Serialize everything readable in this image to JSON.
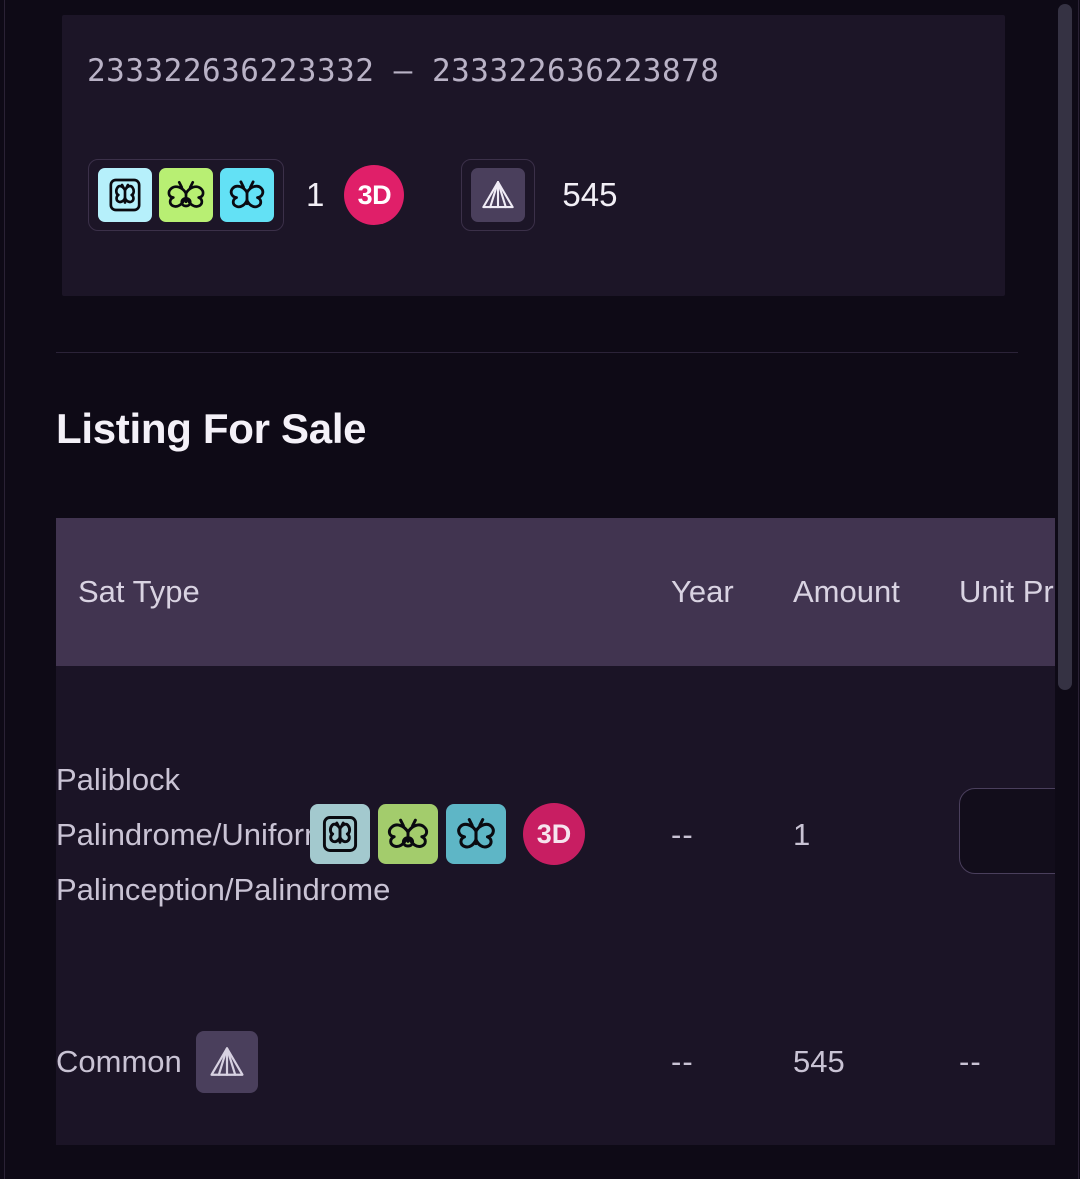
{
  "info_card": {
    "range_start": "233322636223332",
    "range_separator": "–",
    "range_end": "233322636223878",
    "attribute_icons": [
      {
        "name": "butterfly-boxed-icon",
        "bg": "#b6f0fb",
        "label": "Paliblock Palindrome"
      },
      {
        "name": "butterfly-wide-icon",
        "bg": "#b8ef73",
        "label": "Uniform Palinception"
      },
      {
        "name": "butterfly-icon",
        "bg": "#63e1f5",
        "label": "Palindrome"
      }
    ],
    "attribute_count": "1",
    "three_d_badge": "3D",
    "rarity_icon": {
      "name": "pyramid-icon",
      "bg": "#4a3f5c"
    },
    "rarity_count": "545"
  },
  "section": {
    "title": "Listing For Sale"
  },
  "table": {
    "columns": [
      {
        "key": "sat_type",
        "label": "Sat Type"
      },
      {
        "key": "year",
        "label": "Year"
      },
      {
        "key": "amount",
        "label": "Amount"
      },
      {
        "key": "unit_price",
        "label": "Unit Price"
      }
    ],
    "rows": [
      {
        "sat_type": "Paliblock Palindrome/Uniform Palinception/Palindrome",
        "icons": [
          {
            "name": "butterfly-boxed-icon",
            "bg": "#a3c9ce"
          },
          {
            "name": "butterfly-wide-icon",
            "bg": "#a3cc6c"
          },
          {
            "name": "butterfly-icon",
            "bg": "#5eb6c6"
          }
        ],
        "three_d_badge": "3D",
        "year": "--",
        "amount": "1",
        "unit_price": ""
      },
      {
        "sat_type": "Common",
        "icons": [
          {
            "name": "pyramid-icon",
            "bg": "#4a3f5c"
          }
        ],
        "three_d_badge": "",
        "year": "--",
        "amount": "545",
        "unit_price": "--"
      }
    ]
  },
  "colors": {
    "page_bg": "#0e0a16",
    "card_bg": "#1c1527",
    "table_header_bg": "#413450",
    "table_body_bg": "#1b1426",
    "accent_pink": "#e01f69",
    "text_primary": "#f4f1f8",
    "text_secondary": "#c9c3d4",
    "scrollbar_thumb": "#353243"
  },
  "scrollbar": {
    "name": "vertical-scrollbar"
  }
}
